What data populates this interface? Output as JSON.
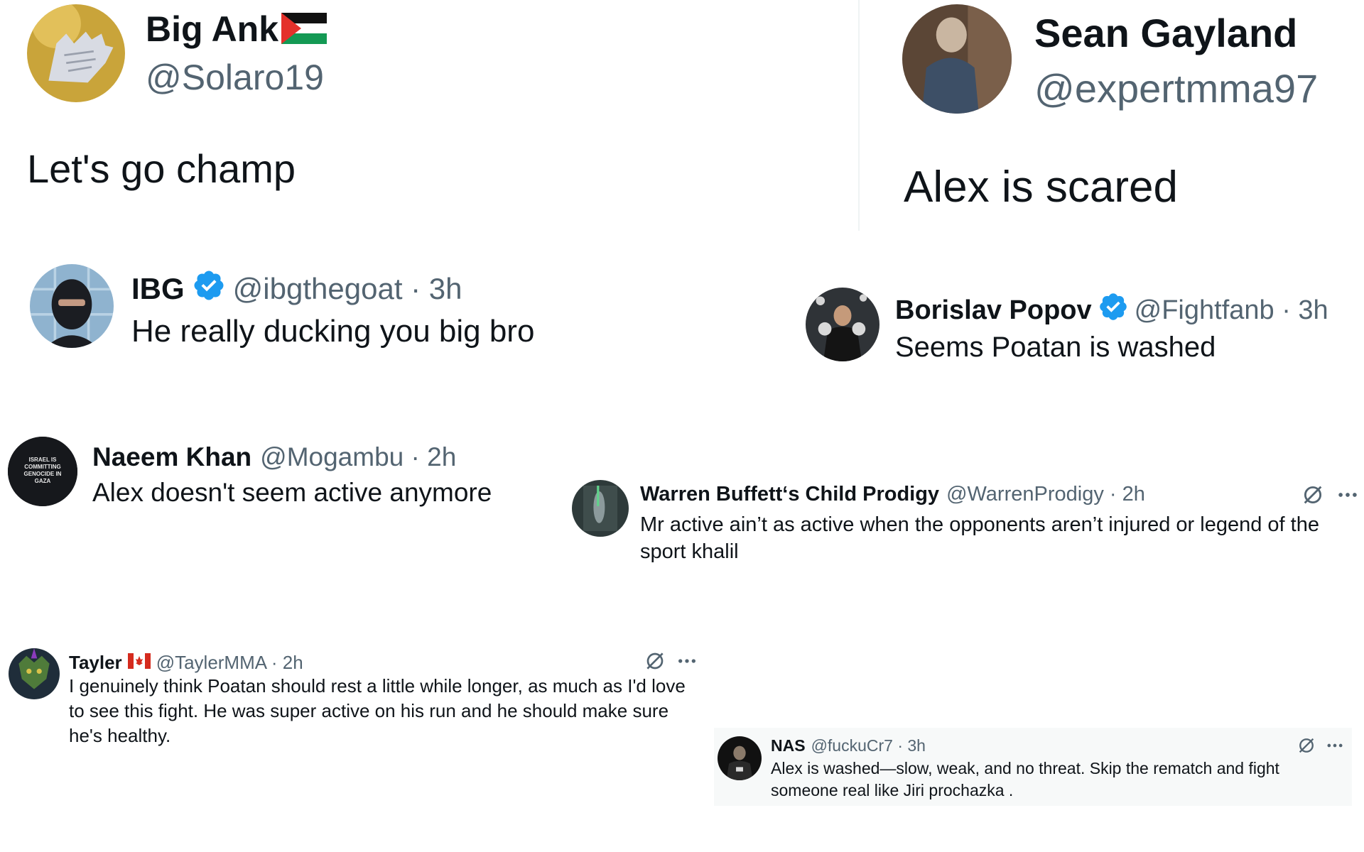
{
  "tweets": {
    "big_ank": {
      "name": "Big Ank",
      "handle": "@Solaro19",
      "text": "Let's go champ"
    },
    "sean": {
      "name": "Sean Gayland",
      "handle": "@expertmma97",
      "text": "Alex is scared"
    },
    "ibg": {
      "name": "IBG",
      "meta": "@ibgthegoat · 3h",
      "text": "He really ducking you big bro"
    },
    "borislav": {
      "name": "Borislav Popov",
      "meta": "@Fightfanb · 3h",
      "text": "Seems Poatan is washed"
    },
    "naeem": {
      "name": "Naeem Khan",
      "meta": "@Mogambu · 2h",
      "text": "Alex doesn't seem active anymore",
      "avatar_text": "ISRAEL IS COMMITTING GENOCIDE IN GAZA"
    },
    "warren": {
      "name": "Warren Buffett‘s Child Prodigy",
      "meta": "@WarrenProdigy · 2h",
      "text": "Mr active ain’t as active when the opponents aren’t injured or legend of the sport khalil"
    },
    "tayler": {
      "name": "Tayler",
      "meta": "@TaylerMMA · 2h",
      "text": "I genuinely think Poatan should rest a little while longer, as much as I'd love to see this fight. He was super active on his run and he should make sure he's healthy."
    },
    "nas": {
      "name": "NAS",
      "meta": "@fuckuCr7 · 3h",
      "text": "Alex is washed—slow, weak, and no threat. Skip the rematch and fight someone real like Jiri prochazka ."
    }
  },
  "icons": {
    "verified": "verified-badge-icon",
    "grok": "grok-icon",
    "more": "more-options-icon",
    "flag_palestine": "palestine-flag-icon",
    "flag_canada": "canada-flag-icon"
  },
  "colors": {
    "text_primary": "#0f1419",
    "text_secondary": "#536471",
    "verified_blue": "#1d9bf0",
    "highlight_bg": "#f7f9f9"
  }
}
